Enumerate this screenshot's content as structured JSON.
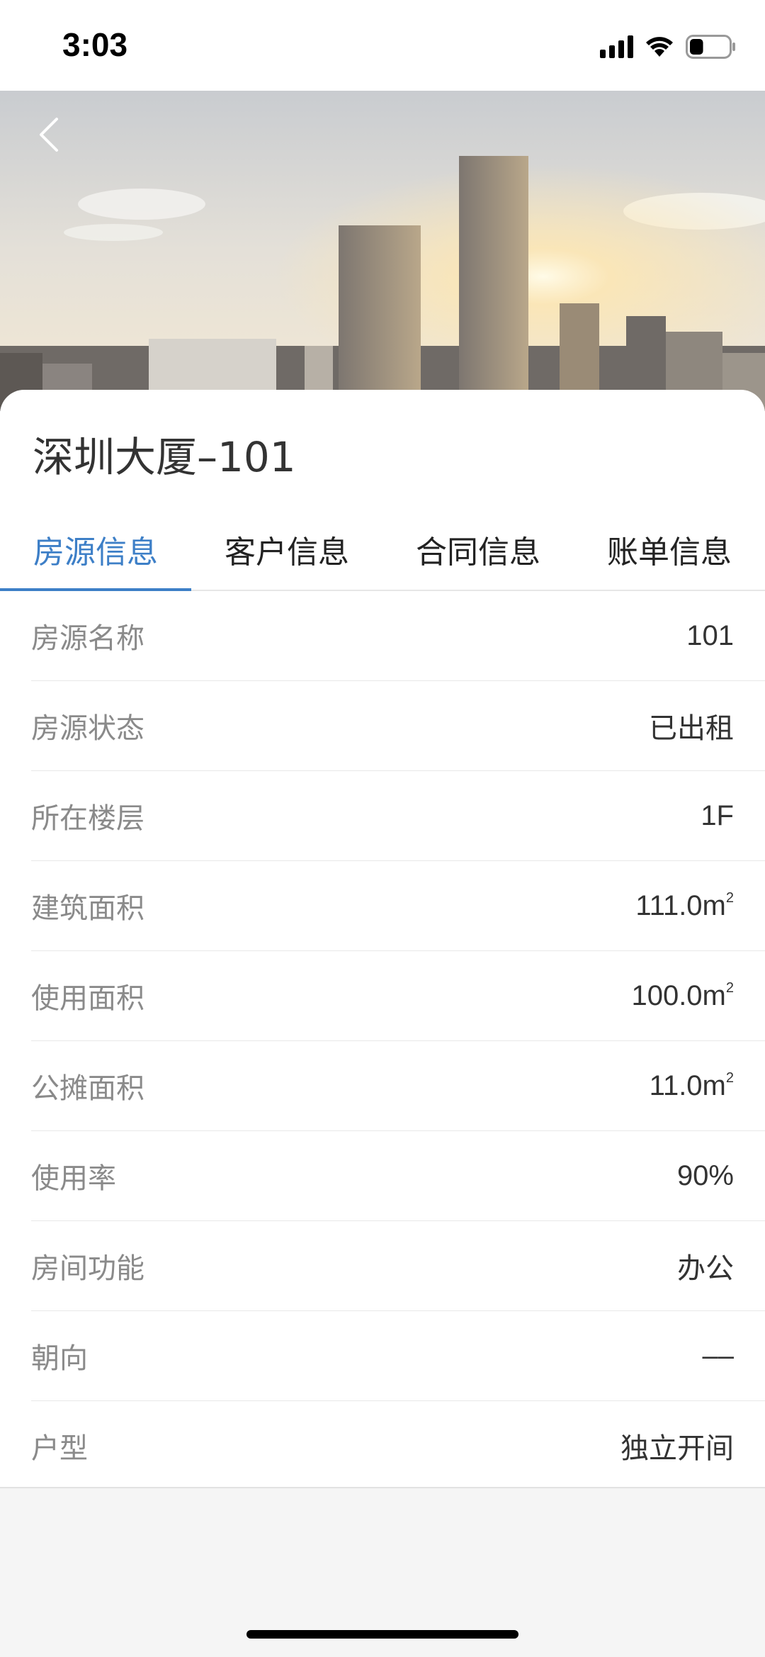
{
  "status_bar": {
    "time": "3:03",
    "icons": [
      "signal-icon",
      "wifi-icon",
      "battery-icon"
    ],
    "battery_level": 0.35
  },
  "header": {
    "back_icon": "chevron-left-icon"
  },
  "property": {
    "title": "深圳大厦–101"
  },
  "tabs": [
    {
      "label": "房源信息",
      "active": true
    },
    {
      "label": "客户信息",
      "active": false
    },
    {
      "label": "合同信息",
      "active": false
    },
    {
      "label": "账单信息",
      "active": false
    }
  ],
  "details": [
    {
      "label": "房源名称",
      "value": "101"
    },
    {
      "label": "房源状态",
      "value": "已出租"
    },
    {
      "label": "所在楼层",
      "value": "1F"
    },
    {
      "label": "建筑面积",
      "value": "111.0m",
      "unit_sup": "2"
    },
    {
      "label": "使用面积",
      "value": "100.0m",
      "unit_sup": "2"
    },
    {
      "label": "公摊面积",
      "value": "11.0m",
      "unit_sup": "2"
    },
    {
      "label": "使用率",
      "value": "90%"
    },
    {
      "label": "房间功能",
      "value": "办公"
    },
    {
      "label": "朝向",
      "value": "––"
    },
    {
      "label": "户型",
      "value": "独立开间"
    }
  ],
  "colors": {
    "accent": "#3d7fc7",
    "label": "#8a8a8a",
    "value": "#333333",
    "background": "#f5f5f5"
  }
}
